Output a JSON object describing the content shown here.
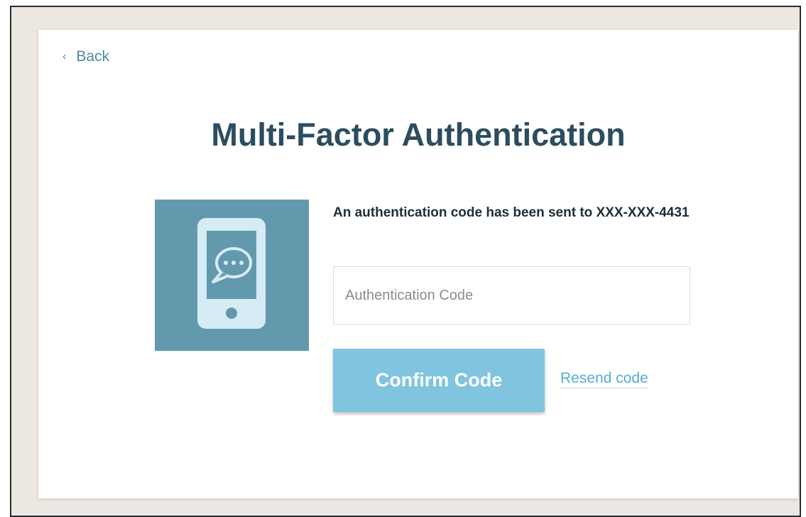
{
  "nav": {
    "back_label": "Back"
  },
  "page": {
    "title": "Multi-Factor Authentication"
  },
  "message": {
    "text": "An authentication code has been sent to XXX-XXX-4431"
  },
  "code_input": {
    "placeholder": "Authentication Code",
    "value": ""
  },
  "actions": {
    "confirm_label": "Confirm Code",
    "resend_label": "Resend code"
  },
  "illustration": {
    "icon": "phone-message-icon"
  },
  "colors": {
    "title": "#2c4d5e",
    "link": "#4a8ba3",
    "illustration_bg": "#6399ad",
    "illustration_fg": "#d5ecf4",
    "button_bg": "#80c4df",
    "resend_link": "#56acd0",
    "frame_bg": "#ece7e1"
  }
}
